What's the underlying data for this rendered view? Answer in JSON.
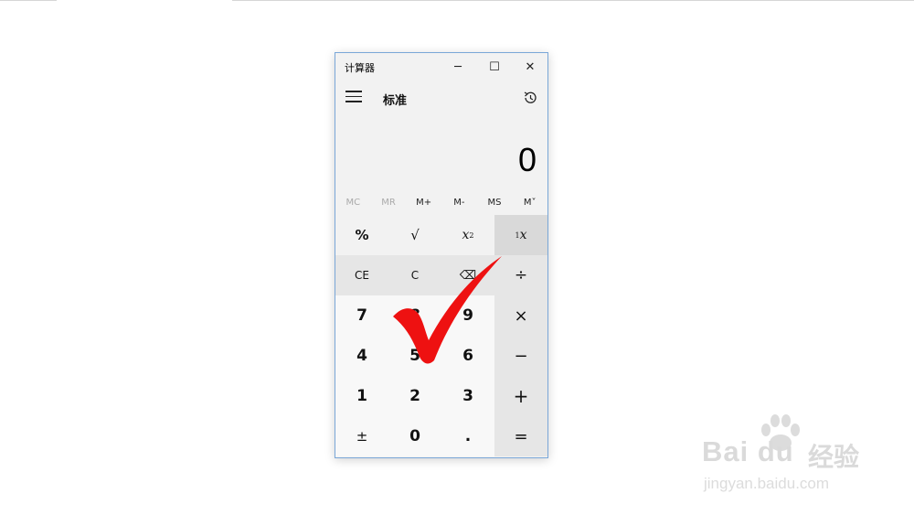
{
  "window": {
    "title": "计算器",
    "minimize_glyph": "─",
    "maximize_glyph": "☐",
    "close_glyph": "✕"
  },
  "header": {
    "mode": "标准",
    "menu_icon": "hamburger-icon",
    "history_icon": "history-icon"
  },
  "display": {
    "value": "0"
  },
  "memory": [
    "MC",
    "MR",
    "M+",
    "M-",
    "MS",
    "M˅"
  ],
  "keys": {
    "percent": "%",
    "sqrt": "√",
    "square_base": "x",
    "square_exp": "2",
    "reciprocal_num": "1",
    "reciprocal_den": "x",
    "ce": "CE",
    "c": "C",
    "backspace": "⌫",
    "divide": "÷",
    "seven": "7",
    "eight": "8",
    "nine": "9",
    "multiply": "×",
    "four": "4",
    "five": "5",
    "six": "6",
    "minus": "−",
    "one": "1",
    "two": "2",
    "three": "3",
    "plus": "+",
    "negate": "±",
    "zero": "0",
    "decimal": ".",
    "equals": "="
  },
  "overlay": {
    "mark": "red-checkmark",
    "color": "#ee1111"
  },
  "watermark": {
    "brand": "Bai du",
    "product": "经验",
    "url": "jingyan.baidu.com"
  }
}
